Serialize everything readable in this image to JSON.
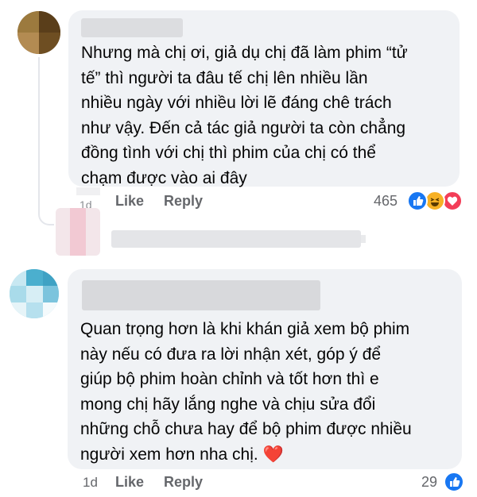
{
  "comments": [
    {
      "text_lines": [
        "Nhưng mà chị ơi, giả dụ chị đã làm phim “tử",
        "tế” thì người ta đâu tế chị lên nhiều lần",
        "nhiều ngày với nhiều lời lẽ đáng chê trách",
        "như vậy. Đến cả tác giả người ta còn chẳng",
        "đồng tình với chị thì phim của chị có thể",
        "chạm được vào ai đây"
      ],
      "time": "1d",
      "like_label": "Like",
      "reply_label": "Reply",
      "reaction_count": "465",
      "reactions": [
        "like-icon",
        "haha-icon",
        "love-icon"
      ]
    },
    {
      "text_lines": [
        "Quan trọng hơn là khi khán giả xem bộ phim",
        "này nếu có đưa ra lời nhận xét, góp ý để",
        "giúp bộ phim hoàn chỉnh và tốt hơn thì e",
        "mong chị hãy lắng nghe và chịu sửa đổi",
        "những chỗ chưa hay để bộ phim được nhiều",
        "người xem hơn nha chị."
      ],
      "emoji": "❤️",
      "time": "1d",
      "like_label": "Like",
      "reply_label": "Reply",
      "reaction_count": "29",
      "reactions": [
        "like-icon"
      ]
    }
  ],
  "colors": {
    "like_blue": "#1877f2",
    "love_red": "#f33e58",
    "haha_yellow": "#f7b125",
    "bubble_bg": "#f0f2f5",
    "meta_gray": "#65676b"
  }
}
